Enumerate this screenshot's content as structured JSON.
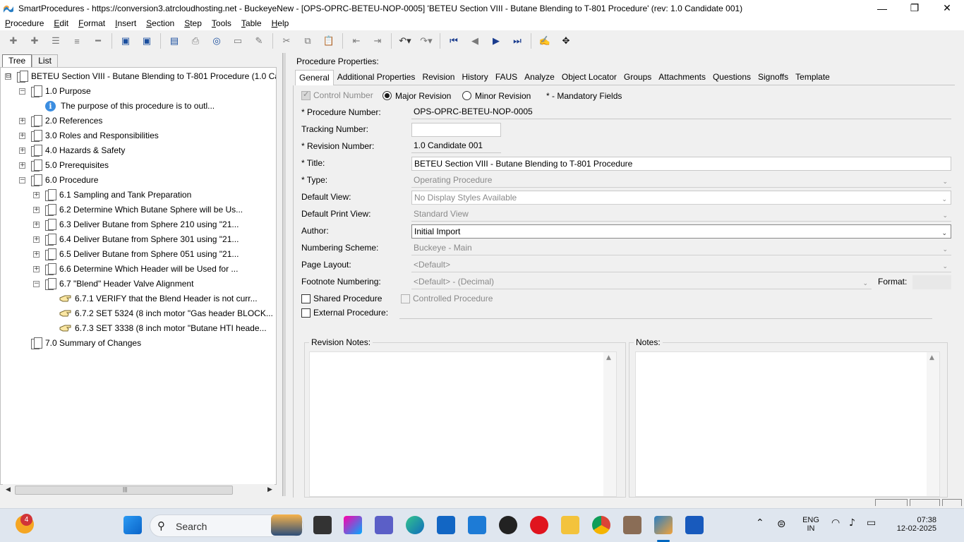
{
  "window": {
    "title": "SmartProcedures - https://conversion3.atrcloudhosting.net - BuckeyeNew - [OPS-OPRC-BETEU-NOP-0005] 'BETEU Section VIII - Butane Blending to T-801 Procedure' (rev: 1.0 Candidate 001)",
    "minimize": "—",
    "restore": "❐",
    "close": "✕"
  },
  "menu": [
    "Procedure",
    "Edit",
    "Format",
    "Insert",
    "Section",
    "Step",
    "Tools",
    "Table",
    "Help"
  ],
  "left": {
    "tabs": [
      "Tree",
      "List"
    ],
    "tree": [
      {
        "label": "BETEU Section VIII - Butane Blending to T-801 Procedure (1.0 Ca...",
        "level": 0,
        "exp": "⊟",
        "icon": "doc"
      },
      {
        "label": "1.0 Purpose",
        "level": 1,
        "exp": "−",
        "icon": "doc"
      },
      {
        "label": "The purpose of this procedure is to outl...",
        "level": 2,
        "exp": "",
        "icon": "info"
      },
      {
        "label": "2.0 References",
        "level": 1,
        "exp": "+",
        "icon": "doc"
      },
      {
        "label": "3.0 Roles and Responsibilities",
        "level": 1,
        "exp": "+",
        "icon": "doc"
      },
      {
        "label": "4.0 Hazards & Safety",
        "level": 1,
        "exp": "+",
        "icon": "doc"
      },
      {
        "label": "5.0 Prerequisites",
        "level": 1,
        "exp": "+",
        "icon": "doc"
      },
      {
        "label": "6.0 Procedure",
        "level": 1,
        "exp": "−",
        "icon": "doc"
      },
      {
        "label": "6.1 Sampling and Tank Preparation",
        "level": 2,
        "exp": "+",
        "icon": "doc"
      },
      {
        "label": "6.2 Determine Which Butane Sphere will be Us...",
        "level": 2,
        "exp": "+",
        "icon": "doc"
      },
      {
        "label": "6.3 Deliver Butane from Sphere 210 using \"21...",
        "level": 2,
        "exp": "+",
        "icon": "doc"
      },
      {
        "label": "6.4 Deliver Butane from Sphere 301 using \"21...",
        "level": 2,
        "exp": "+",
        "icon": "doc"
      },
      {
        "label": "6.5 Deliver Butane from Sphere 051 using \"21...",
        "level": 2,
        "exp": "+",
        "icon": "doc"
      },
      {
        "label": "6.6 Determine Which Header will be Used for ...",
        "level": 2,
        "exp": "+",
        "icon": "doc"
      },
      {
        "label": "6.7 \"Blend\" Header Valve Alignment",
        "level": 2,
        "exp": "−",
        "icon": "doc"
      },
      {
        "label": "6.7.1 VERIFY that the Blend Header is not curr...",
        "level": 3,
        "exp": "",
        "icon": "hand"
      },
      {
        "label": "6.7.2 SET 5324 (8 inch motor \"Gas header BLOCK...",
        "level": 3,
        "exp": "",
        "icon": "hand"
      },
      {
        "label": "6.7.3 SET 3338 (8 inch motor \"Butane HTI heade...",
        "level": 3,
        "exp": "",
        "icon": "hand"
      },
      {
        "label": "7.0 Summary of Changes",
        "level": 1,
        "exp": "",
        "icon": "doc"
      }
    ]
  },
  "right": {
    "header": "Procedure Properties:",
    "tabs": [
      "General",
      "Additional Properties",
      "Revision",
      "History",
      "FAUS",
      "Analyze",
      "Object Locator",
      "Groups",
      "Attachments",
      "Questions",
      "Signoffs",
      "Template"
    ],
    "control_number": "Control Number",
    "major_revision": "Major Revision",
    "minor_revision": "Minor Revision",
    "mandatory_note": "* - Mandatory Fields",
    "fields": {
      "procedure_number": {
        "label": "* Procedure Number:",
        "value": "OPS-OPRC-BETEU-NOP-0005"
      },
      "tracking_number": {
        "label": "Tracking Number:",
        "value": ""
      },
      "revision_number": {
        "label": "* Revision Number:",
        "value": "1.0 Candidate 001"
      },
      "title": {
        "label": "* Title:",
        "value": "BETEU Section VIII - Butane Blending to T-801 Procedure"
      },
      "type": {
        "label": "* Type:",
        "value": "Operating Procedure"
      },
      "default_view": {
        "label": "Default View:",
        "value": "No Display Styles Available"
      },
      "default_print_view": {
        "label": "Default Print View:",
        "value": "Standard View"
      },
      "author": {
        "label": "Author:",
        "value": "Initial Import"
      },
      "numbering_scheme": {
        "label": "Numbering Scheme:",
        "value": "Buckeye - Main"
      },
      "page_layout": {
        "label": "Page Layout:",
        "value": "<Default>"
      },
      "footnote_numbering": {
        "label": "Footnote Numbering:",
        "value": "<Default> - (Decimal)"
      },
      "format": {
        "label": "Format:",
        "value": ""
      }
    },
    "shared_procedure": "Shared Procedure",
    "controlled_procedure": "Controlled Procedure",
    "external_procedure": "External Procedure:",
    "revision_notes": "Revision Notes:",
    "notes": "Notes:"
  },
  "taskbar": {
    "search": "Search",
    "notification_count": "4",
    "lang_top": "ENG",
    "lang_bottom": "IN",
    "time": "07:38",
    "date": "12-02-2025"
  }
}
